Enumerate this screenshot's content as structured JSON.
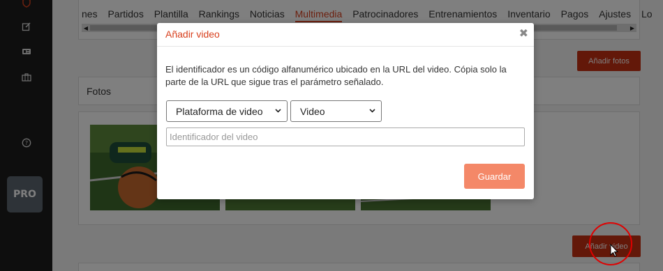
{
  "sidebar": {
    "icons": [
      "shield-icon",
      "edit-icon",
      "id-card-icon",
      "briefcase-icon",
      "help-icon"
    ],
    "pro_label": "PRO"
  },
  "tabs": [
    {
      "label": "nes",
      "active": false
    },
    {
      "label": "Partidos",
      "active": false
    },
    {
      "label": "Plantilla",
      "active": false
    },
    {
      "label": "Rankings",
      "active": false
    },
    {
      "label": "Noticias",
      "active": false
    },
    {
      "label": "Multimedia",
      "active": true
    },
    {
      "label": "Patrocinadores",
      "active": false
    },
    {
      "label": "Entrenamientos",
      "active": false
    },
    {
      "label": "Inventario",
      "active": false
    },
    {
      "label": "Pagos",
      "active": false
    },
    {
      "label": "Ajustes",
      "active": false
    },
    {
      "label": "Lo",
      "active": false
    }
  ],
  "main": {
    "add_photos_label": "Añadir fotos",
    "photos_title": "Fotos",
    "add_video_label": "Añadir video"
  },
  "modal": {
    "title": "Añadir video",
    "close_glyph": "✖",
    "description": "El identificador es un código alfanumérico ubicado en la URL del video. Cópia solo la parte de la URL que sigue tras el parámetro señalado.",
    "platform_select": "Plataforma de video",
    "type_select": "Video",
    "id_placeholder": "Identificador del video",
    "save_label": "Guardar"
  },
  "colors": {
    "accent": "#d8401e",
    "button_red": "#c63012",
    "save_button": "#f48868",
    "sidebar": "#1c1c1c",
    "pro_badge": "#5d6770"
  }
}
